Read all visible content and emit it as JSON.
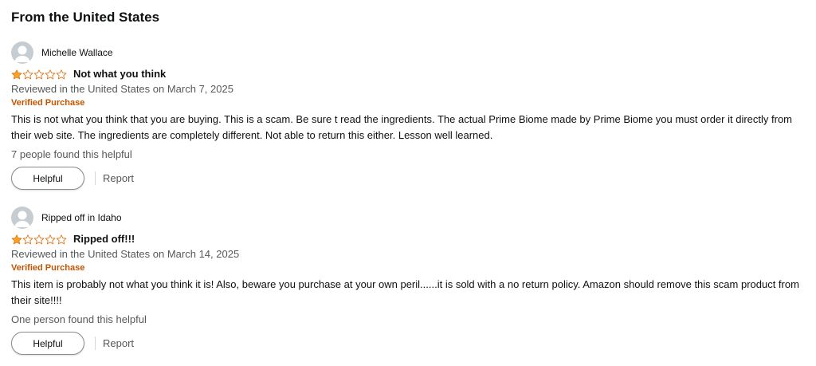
{
  "section_title": "From the United States",
  "colors": {
    "star_fill": "#ffa41c",
    "star_outline": "#de7921",
    "verified": "#c45500",
    "muted": "#565959"
  },
  "reviews": [
    {
      "profile_name": "Michelle Wallace",
      "rating": 1,
      "max_rating": 5,
      "title": "Not what you think",
      "date": "Reviewed in the United States on March 7, 2025",
      "verified": "Verified Purchase",
      "body": "This is not what you think that you are buying. This is a scam. Be sure t read the ingredients. The actual Prime Biome made by Prime Biome you must order it directly from their web site. The ingredients are completely different. Not able to return this either. Lesson well learned.",
      "helpful_count": "7 people found this helpful",
      "helpful_label": "Helpful",
      "report_label": "Report"
    },
    {
      "profile_name": "Ripped off in Idaho",
      "rating": 1,
      "max_rating": 5,
      "title": "Ripped off!!!",
      "date": "Reviewed in the United States on March 14, 2025",
      "verified": "Verified Purchase",
      "body": "This item is probably not what you think it is! Also, beware you purchase at your own peril......it is sold with a no return policy. Amazon should remove this scam product from their site!!!!",
      "helpful_count": "One person found this helpful",
      "helpful_label": "Helpful",
      "report_label": "Report"
    }
  ]
}
